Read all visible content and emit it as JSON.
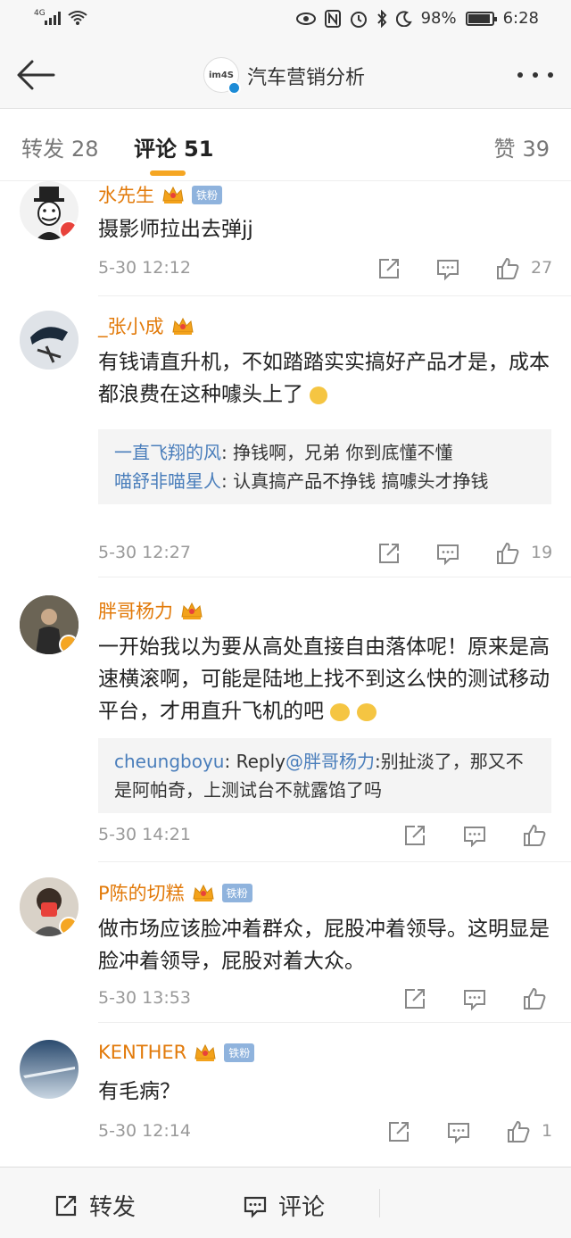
{
  "status_bar": {
    "network": "4G",
    "battery_percent": "98%",
    "time": "6:28"
  },
  "header": {
    "account_avatar_text": "im4S",
    "title": "汽车营销分析"
  },
  "tabs": {
    "repost": {
      "label": "转发",
      "count": "28"
    },
    "comment": {
      "label": "评论",
      "count": "51"
    },
    "like": {
      "label": "赞",
      "count": "39"
    }
  },
  "comments": [
    {
      "name": "水先生",
      "fan_badge": "铁粉",
      "text": "摄影师拉出去弹jj",
      "time": "5-30 12:12",
      "likes": "27"
    },
    {
      "name": "_张小成",
      "text": "有钱请直升机，不如踏踏实实搞好产品才是，成本都浪费在这种噱头上了",
      "replies": [
        {
          "name": "一直飞翔的风",
          "text": ": 挣钱啊，兄弟 你到底懂不懂"
        },
        {
          "name": "喵舒非喵星人",
          "text": ": 认真搞产品不挣钱 搞噱头才挣钱"
        }
      ],
      "time": "5-30 12:27",
      "likes": "19"
    },
    {
      "name": "胖哥杨力",
      "text": "一开始我以为要从高处直接自由落体呢！原来是高速横滚啊，可能是陆地上找不到这么快的测试移动平台，才用直升飞机的吧",
      "replies": [
        {
          "name": "cheungboyu",
          "text": ": Reply",
          "mention": "@胖哥杨力",
          "text2": ":别扯淡了，那又不是阿帕奇，上测试台不就露馅了吗"
        }
      ],
      "time": "5-30 14:21",
      "likes": ""
    },
    {
      "name": "P陈的切糕",
      "fan_badge": "铁粉",
      "text": "做市场应该脸冲着群众，屁股冲着领导。这明显是脸冲着领导，屁股对着大众。",
      "time": "5-30 13:53",
      "likes": ""
    },
    {
      "name": "KENTHER",
      "fan_badge": "铁粉",
      "text": "有毛病？",
      "time": "5-30 12:14",
      "likes": "1"
    }
  ],
  "bottom_bar": {
    "repost_label": "转发",
    "comment_label": "评论"
  },
  "colors": {
    "username": "#e27a0a",
    "reply_name": "#4a7ebb",
    "tab_accent": "#f5a623",
    "verified_orange": "#f5a623",
    "verified_blue": "#1c8bd6"
  }
}
